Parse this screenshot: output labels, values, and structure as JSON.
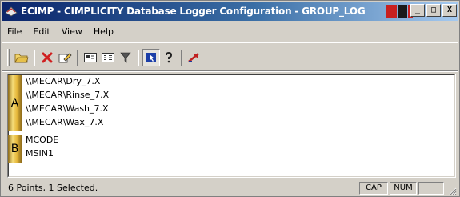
{
  "window": {
    "title": "ECIMP - CIMPLICITY Database Logger Configuration - GROUP_LOG",
    "minimize_label": "_",
    "maximize_label": "□",
    "close_label": "X"
  },
  "menu": {
    "items": [
      "File",
      "Edit",
      "View",
      "Help"
    ]
  },
  "toolbar": {
    "icons": [
      "open-folder-icon",
      "delete-icon",
      "edit-icon",
      "large-icons-icon",
      "small-icons-icon",
      "filter-icon",
      "pointer-icon",
      "help-icon",
      "arrow-icon"
    ]
  },
  "groups": [
    {
      "label": "A",
      "items": [
        "\\\\MECAR\\Dry_7.X",
        "\\\\MECAR\\Rinse_7.X",
        "\\\\MECAR\\Wash_7.X",
        "\\\\MECAR\\Wax_7.X"
      ]
    },
    {
      "label": "B",
      "items": [
        "MCODE",
        "MSIN1"
      ]
    }
  ],
  "status": {
    "text": "6 Points, 1 Selected.",
    "caps_label": "CAP",
    "num_label": "NUM",
    "scroll_label": ""
  },
  "colors": {
    "title_gradient_start": "#0a246a",
    "title_gradient_end": "#a6caf0",
    "group_tab_gold": "#e6b83a"
  }
}
